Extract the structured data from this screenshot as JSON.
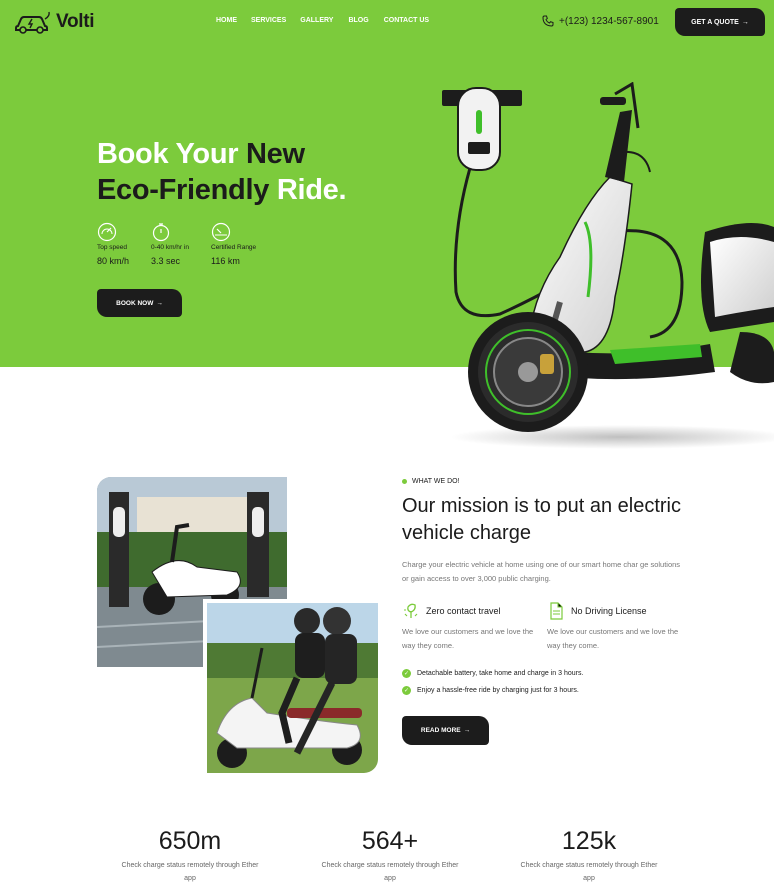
{
  "brand": {
    "name": "Volti"
  },
  "nav": {
    "items": [
      "HOME",
      "SERVICES",
      "GALLERY",
      "BLOG",
      "CONTACT US"
    ],
    "phone": "+(123) 1234-567-8901",
    "quote_label": "GET A QUOTE"
  },
  "hero": {
    "title_part1": "Book Your",
    "title_part2": "New",
    "title_part3": "Eco-Friendly",
    "title_part4": "Ride.",
    "stats": [
      {
        "icon": "speedometer-icon",
        "label": "Top speed",
        "value": "80 km/h"
      },
      {
        "icon": "stopwatch-icon",
        "label": "0-40 km/hr in",
        "value": "3.3 sec"
      },
      {
        "icon": "gauge-icon",
        "label": "Certified Range",
        "value": "116 km"
      }
    ],
    "book_label": "BOOK NOW"
  },
  "mission": {
    "tag": "WHAT WE DO!",
    "title": "Our mission is to put an electric vehicle charge",
    "description": "Charge your electric vehicle at home using one of our smart home char ge solutions or gain access to over 3,000 public charging.",
    "features": [
      {
        "icon": "leaf-plug-icon",
        "title": "Zero contact travel",
        "text": "We love our customers and we love the way they come."
      },
      {
        "icon": "document-icon",
        "title": "No Driving License",
        "text": "We love our customers and we love the way they come."
      }
    ],
    "checks": [
      "Detachable battery, take home and charge in 3 hours.",
      "Enjoy a hassle-free ride by charging just for 3 hours."
    ],
    "read_label": "READ MORE"
  },
  "counters": [
    {
      "number": "650m",
      "text": "Check charge status remotely through Ether app"
    },
    {
      "number": "564+",
      "text": "Check charge status remotely through Ether app"
    },
    {
      "number": "125k",
      "text": "Check charge status remotely through Ether app"
    }
  ],
  "colors": {
    "accent": "#7ccb3c",
    "dark": "#1c1c1c",
    "muted": "#777777"
  }
}
